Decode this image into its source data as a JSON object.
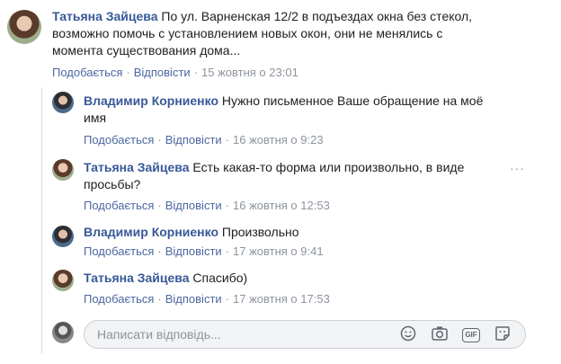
{
  "comments": [
    {
      "author": "Татьяна Зайцева",
      "text_l1": "По ул. Варненская 12/2 в подъездах окна без стекол,",
      "text_l2": "возможно помочь с установлением новых окон, они не менялись с",
      "text_l3": "момента существования дома...",
      "like": "Подобається",
      "reply": "Відповісти",
      "time": "15 жовтня о 23:01"
    },
    {
      "author": "Владимир Корниенко",
      "text_l1": "Нужно письменное Ваше обращение на моё",
      "text_l2": "имя",
      "like": "Подобається",
      "reply": "Відповісти",
      "time": "16 жовтня о 9:23"
    },
    {
      "author": "Татьяна Зайцева",
      "text_l1": "Есть какая-то форма или произвольно, в виде",
      "text_l2": "просьбы?",
      "like": "Подобається",
      "reply": "Відповісти",
      "time": "16 жовтня о 12:53"
    },
    {
      "author": "Владимир Корниенко",
      "text_l1": "Произвольно",
      "like": "Подобається",
      "reply": "Відповісти",
      "time": "17 жовтня о 9:41"
    },
    {
      "author": "Татьяна Зайцева",
      "text_l1": "Спасибо)",
      "like": "Подобається",
      "reply": "Відповісти",
      "time": "17 жовтня о 17:53"
    }
  ],
  "reply_input": {
    "placeholder": "Написати відповідь..."
  },
  "icons": {
    "emoji": "smile-icon",
    "camera": "camera-icon",
    "gif": "GIF",
    "sticker": "sticker-icon",
    "more": "more-options-icon"
  },
  "colors": {
    "author": "#385898",
    "link": "#4b67a1",
    "meta": "#8d949e"
  }
}
